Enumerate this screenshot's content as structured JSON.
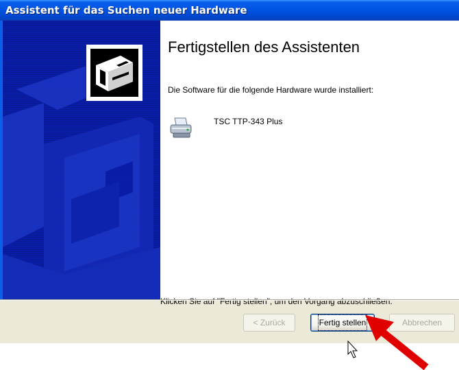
{
  "window": {
    "title": "Assistent für das Suchen neuer Hardware"
  },
  "wizard": {
    "heading": "Fertigstellen des Assistenten",
    "intro": "Die Software für die folgende Hardware wurde installiert:",
    "device_name": "TSC TTP-343 Plus",
    "device_icon": "printer-icon",
    "finish_hint": "Klicken Sie auf \"Fertig stellen\", um den Vorgang abzuschließen."
  },
  "buttons": {
    "back": "< Zurück",
    "finish": "Fertig stellen",
    "cancel": "Abbrechen"
  },
  "colors": {
    "titlebar": "#0054E3",
    "side_panel": "#0a1da8",
    "dialog_face": "#ECE9D8",
    "annotation_arrow": "#E00000"
  }
}
